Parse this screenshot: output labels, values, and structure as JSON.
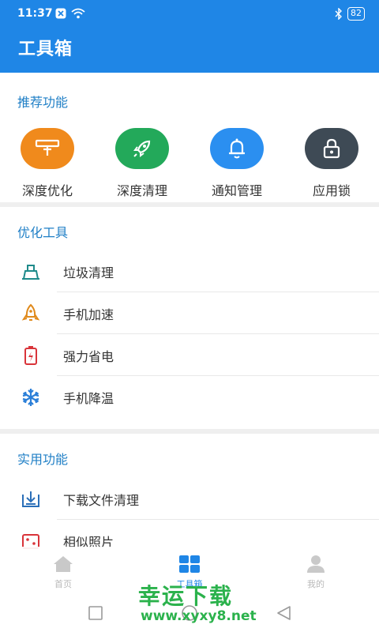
{
  "status_bar": {
    "time": "11:37",
    "battery": "82"
  },
  "header": {
    "title": "工具箱"
  },
  "recommend": {
    "title": "推荐功能",
    "items": [
      {
        "label": "深度优化",
        "color": "#f08a1c",
        "icon": "broom-icon"
      },
      {
        "label": "深度清理",
        "color": "#23a95a",
        "icon": "rocket-icon"
      },
      {
        "label": "通知管理",
        "color": "#2b8ff0",
        "icon": "bell-icon"
      },
      {
        "label": "应用锁",
        "color": "#3e4a55",
        "icon": "lock-icon"
      }
    ]
  },
  "optimize": {
    "title": "优化工具",
    "items": [
      {
        "label": "垃圾清理",
        "icon": "broom-icon",
        "color": "#1e8a8a"
      },
      {
        "label": "手机加速",
        "icon": "rocket-icon",
        "color": "#e08a1c"
      },
      {
        "label": "强力省电",
        "icon": "battery-icon",
        "color": "#d9343a"
      },
      {
        "label": "手机降温",
        "icon": "snowflake-icon",
        "color": "#2b7fd8"
      }
    ]
  },
  "utility": {
    "title": "实用功能",
    "items": [
      {
        "label": "下载文件清理",
        "icon": "download-icon",
        "color": "#2b6fb8"
      },
      {
        "label": "相似照片",
        "icon": "photo-icon",
        "color": "#d9343a"
      }
    ]
  },
  "bottom_nav": {
    "items": [
      {
        "label": "首页",
        "icon": "home-icon",
        "active": false
      },
      {
        "label": "工具箱",
        "icon": "grid-icon",
        "active": true
      },
      {
        "label": "我的",
        "icon": "user-icon",
        "active": false
      }
    ]
  },
  "watermark": {
    "text": "幸运下载",
    "url": "www.xyxy8.net"
  }
}
